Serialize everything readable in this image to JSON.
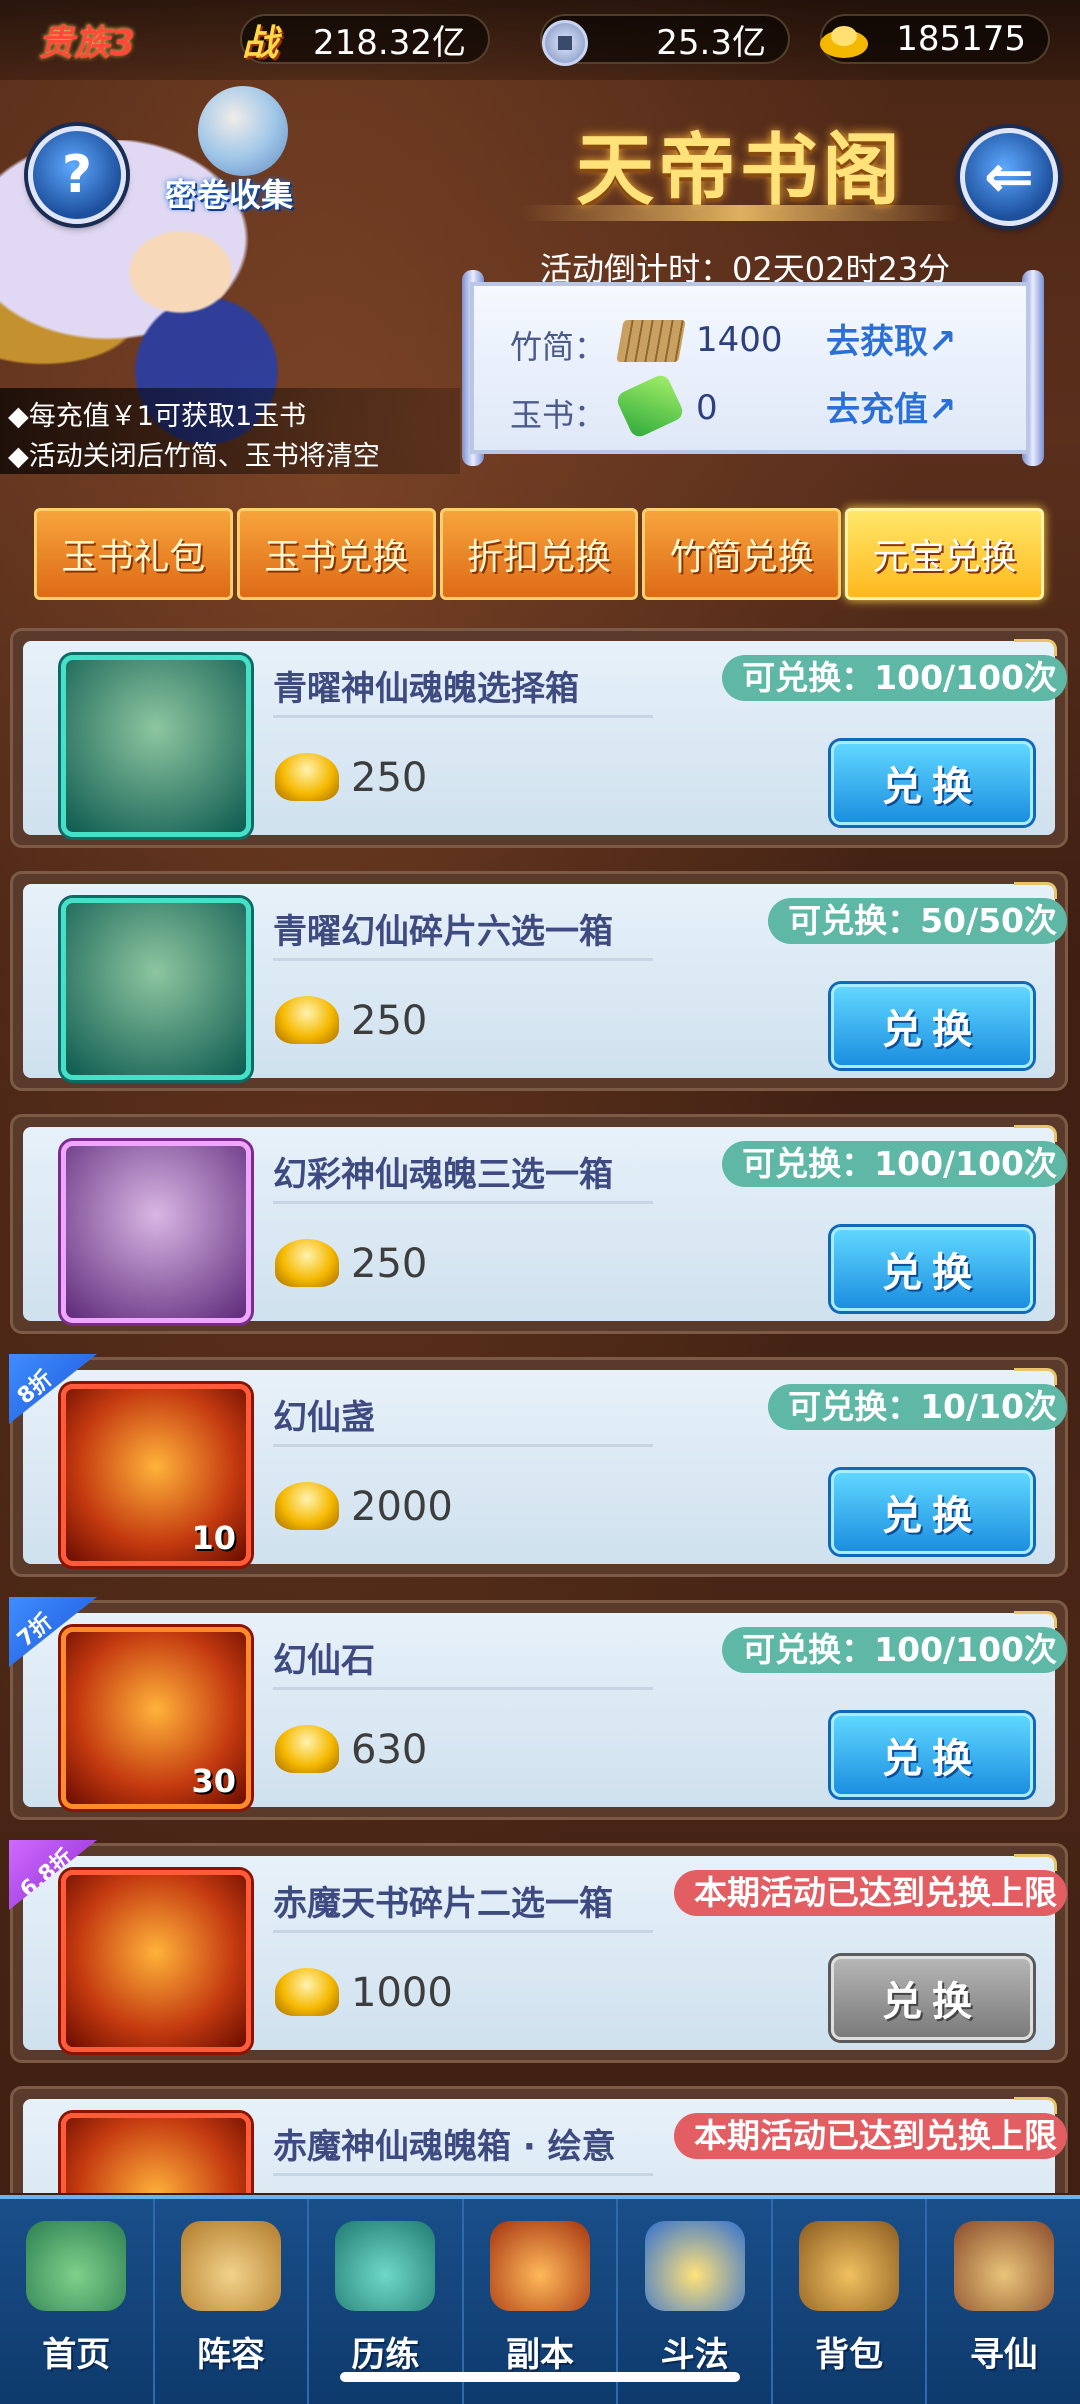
{
  "topbar": {
    "vip": "贵族3",
    "power_icon": "战",
    "power": "218.32亿",
    "copper": "25.3亿",
    "ingot": "185175"
  },
  "header": {
    "title": "天帝书阁",
    "scroll_label": "密卷收集",
    "countdown": "活动倒计时：02天02时23分",
    "help_icon": "?",
    "back_icon": "⇐"
  },
  "notes": [
    "◆每充值￥1可获取1玉书",
    "◆活动关闭后竹简、玉书将清空"
  ],
  "currency_panel": {
    "bamboo_label": "竹简：",
    "bamboo_value": "1400",
    "bamboo_link": "去获取↗",
    "jade_label": "玉书：",
    "jade_value": "0",
    "jade_link": "去充值↗"
  },
  "tabs": [
    {
      "label": "玉书礼包",
      "active": false
    },
    {
      "label": "玉书兑换",
      "active": false
    },
    {
      "label": "折扣兑换",
      "active": false
    },
    {
      "label": "竹简兑换",
      "active": false
    },
    {
      "label": "元宝兑换",
      "active": true
    }
  ],
  "items": [
    {
      "name": "青曜神仙魂魄选择箱",
      "price": "250",
      "limit": "可兑换：100/100次",
      "button": "兑换",
      "qty": "",
      "discount": ""
    },
    {
      "name": "青曜幻仙碎片六选一箱",
      "price": "250",
      "limit": "可兑换：50/50次",
      "button": "兑换",
      "qty": "",
      "discount": ""
    },
    {
      "name": "幻彩神仙魂魄三选一箱",
      "price": "250",
      "limit": "可兑换：100/100次",
      "button": "兑换",
      "qty": "",
      "discount": ""
    },
    {
      "name": "幻仙盏",
      "price": "2000",
      "limit": "可兑换：10/10次",
      "button": "兑换",
      "qty": "10",
      "discount": "8折"
    },
    {
      "name": "幻仙石",
      "price": "630",
      "limit": "可兑换：100/100次",
      "button": "兑换",
      "qty": "30",
      "discount": "7折"
    },
    {
      "name": "赤魔天书碎片二选一箱",
      "price": "1000",
      "limit": "本期活动已达到兑换上限",
      "button": "兑换",
      "qty": "",
      "discount": "6.8折"
    },
    {
      "name": "赤魔神仙魂魄箱 · 绘意",
      "price": "",
      "limit": "本期活动已达到兑换上限",
      "button": "",
      "qty": "",
      "discount": ""
    }
  ],
  "nav": [
    {
      "label": "首页",
      "icon": "home-icon"
    },
    {
      "label": "阵容",
      "icon": "lineup-icon"
    },
    {
      "label": "历练",
      "icon": "training-icon"
    },
    {
      "label": "副本",
      "icon": "dungeon-icon"
    },
    {
      "label": "斗法",
      "icon": "battle-icon"
    },
    {
      "label": "背包",
      "icon": "backpack-icon"
    },
    {
      "label": "寻仙",
      "icon": "seek-immortal-icon"
    }
  ]
}
